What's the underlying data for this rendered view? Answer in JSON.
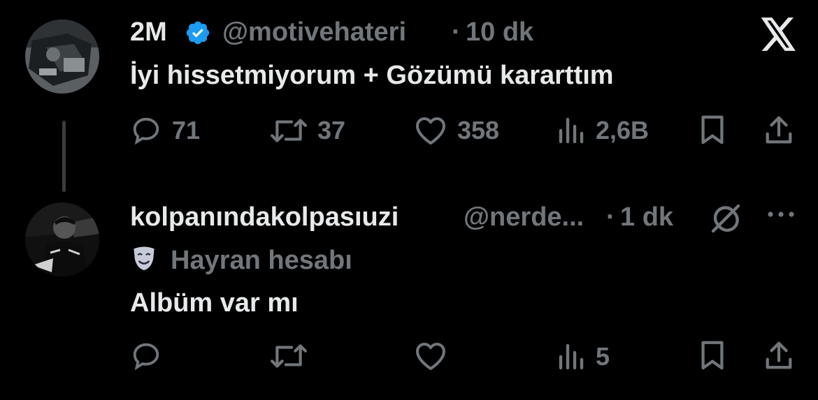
{
  "tweet": {
    "display_name": "2M",
    "handle": "@motivehateri",
    "separator": "·",
    "time": "10 dk",
    "text": "İyi hissetmiyorum + Gözümü kararttım",
    "replies": "71",
    "retweets": "37",
    "likes": "358",
    "views": "2,6B"
  },
  "reply": {
    "display_name": "kolpanındakolpasıuzi",
    "handle": "@nerde...",
    "separator": "·",
    "time": "1 dk",
    "label": "Hayran hesabı",
    "text": "Albüm var mı",
    "views": "5"
  },
  "colors": {
    "background": "#000000",
    "primary_text": "#e7e9ea",
    "secondary_text": "#71767b",
    "verified_blue": "#1d9bf0",
    "thread_line": "#3a3d40"
  },
  "icons": [
    "x-logo-icon",
    "verified-badge-icon",
    "reply-icon",
    "retweet-icon",
    "like-icon",
    "views-icon",
    "bookmark-icon",
    "share-icon",
    "mask-icon",
    "grok-icon",
    "more-icon"
  ]
}
